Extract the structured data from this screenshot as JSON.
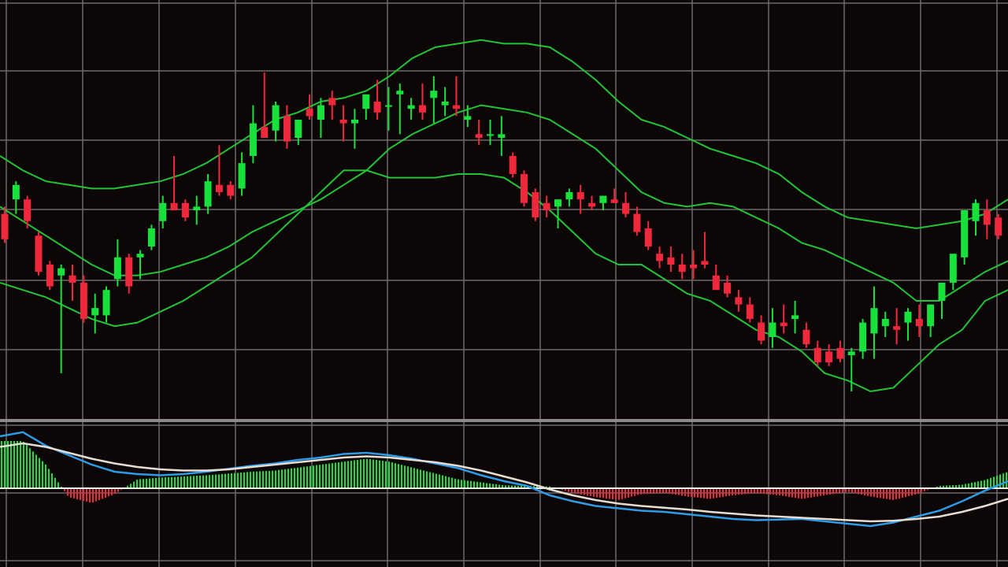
{
  "colors": {
    "background": "#0d0606",
    "grid": "#6e6a6a",
    "separator": "#8a8a8a",
    "bullish": "#19e13c",
    "bearish": "#f0283c",
    "band": "#22c437",
    "macd_line": "#2e9be6",
    "signal_line": "#e6dcd2",
    "zero_line": "#f2f2f2"
  },
  "chart_data": [
    {
      "type": "candlestick",
      "title": "",
      "xlabel": "",
      "ylabel": "",
      "ylim": [
        0,
        100
      ],
      "grid": true,
      "overlays": [
        "bollinger-upper",
        "bollinger-middle",
        "bollinger-lower"
      ],
      "candles": [
        {
          "o": 54,
          "h": 56,
          "l": 46,
          "c": 47
        },
        {
          "o": 58,
          "h": 63,
          "l": 54,
          "c": 62
        },
        {
          "o": 58,
          "h": 59,
          "l": 50,
          "c": 52
        },
        {
          "o": 48,
          "h": 49,
          "l": 37,
          "c": 38
        },
        {
          "o": 40,
          "h": 41,
          "l": 33,
          "c": 34
        },
        {
          "o": 37,
          "h": 40,
          "l": 10,
          "c": 39
        },
        {
          "o": 37,
          "h": 40,
          "l": 30,
          "c": 35
        },
        {
          "o": 35,
          "h": 37,
          "l": 24,
          "c": 25
        },
        {
          "o": 26,
          "h": 32,
          "l": 21,
          "c": 28
        },
        {
          "o": 26,
          "h": 34,
          "l": 24,
          "c": 33
        },
        {
          "o": 36,
          "h": 47,
          "l": 34,
          "c": 42
        },
        {
          "o": 42,
          "h": 43,
          "l": 32,
          "c": 34
        },
        {
          "o": 42,
          "h": 44,
          "l": 36,
          "c": 43
        },
        {
          "o": 45,
          "h": 51,
          "l": 44,
          "c": 50
        },
        {
          "o": 52,
          "h": 59,
          "l": 50,
          "c": 57
        },
        {
          "o": 57,
          "h": 70,
          "l": 55,
          "c": 55
        },
        {
          "o": 57,
          "h": 58,
          "l": 52,
          "c": 53
        },
        {
          "o": 55,
          "h": 59,
          "l": 51,
          "c": 56
        },
        {
          "o": 56,
          "h": 65,
          "l": 54,
          "c": 63
        },
        {
          "o": 62,
          "h": 73,
          "l": 59,
          "c": 60
        },
        {
          "o": 62,
          "h": 63,
          "l": 58,
          "c": 59
        },
        {
          "o": 61,
          "h": 71,
          "l": 59,
          "c": 68
        },
        {
          "o": 70,
          "h": 84,
          "l": 68,
          "c": 79
        },
        {
          "o": 78,
          "h": 93,
          "l": 75,
          "c": 75
        },
        {
          "o": 77,
          "h": 85,
          "l": 74,
          "c": 84
        },
        {
          "o": 81,
          "h": 84,
          "l": 72,
          "c": 74
        },
        {
          "o": 75,
          "h": 78,
          "l": 73,
          "c": 80
        },
        {
          "o": 83,
          "h": 87,
          "l": 80,
          "c": 81
        },
        {
          "o": 80,
          "h": 86,
          "l": 75,
          "c": 84
        },
        {
          "o": 86,
          "h": 88,
          "l": 80,
          "c": 84
        },
        {
          "o": 80,
          "h": 84,
          "l": 74,
          "c": 79
        },
        {
          "o": 79,
          "h": 83,
          "l": 72,
          "c": 80
        },
        {
          "o": 83,
          "h": 86,
          "l": 80,
          "c": 87
        },
        {
          "o": 85,
          "h": 91,
          "l": 80,
          "c": 82
        },
        {
          "o": 84,
          "h": 89,
          "l": 77,
          "c": 84
        },
        {
          "o": 87,
          "h": 90,
          "l": 76,
          "c": 88
        },
        {
          "o": 83,
          "h": 86,
          "l": 80,
          "c": 84
        },
        {
          "o": 84,
          "h": 90,
          "l": 80,
          "c": 82
        },
        {
          "o": 86,
          "h": 92,
          "l": 79,
          "c": 88
        },
        {
          "o": 84,
          "h": 89,
          "l": 81,
          "c": 85
        },
        {
          "o": 84,
          "h": 92,
          "l": 81,
          "c": 83
        },
        {
          "o": 80,
          "h": 84,
          "l": 78,
          "c": 81
        },
        {
          "o": 76,
          "h": 80,
          "l": 73,
          "c": 75
        },
        {
          "o": 76,
          "h": 80,
          "l": 73,
          "c": 76
        },
        {
          "o": 75,
          "h": 81,
          "l": 70,
          "c": 76
        },
        {
          "o": 70,
          "h": 71,
          "l": 64,
          "c": 65
        },
        {
          "o": 65,
          "h": 66,
          "l": 56,
          "c": 57
        },
        {
          "o": 60,
          "h": 61,
          "l": 52,
          "c": 53
        },
        {
          "o": 57,
          "h": 59,
          "l": 53,
          "c": 55
        },
        {
          "o": 56,
          "h": 58,
          "l": 50,
          "c": 58
        },
        {
          "o": 58,
          "h": 61,
          "l": 56,
          "c": 60
        },
        {
          "o": 60,
          "h": 62,
          "l": 54,
          "c": 58
        },
        {
          "o": 57,
          "h": 59,
          "l": 55,
          "c": 56
        },
        {
          "o": 57,
          "h": 59,
          "l": 55,
          "c": 59
        },
        {
          "o": 58,
          "h": 61,
          "l": 57,
          "c": 57
        },
        {
          "o": 57,
          "h": 60,
          "l": 53,
          "c": 54
        },
        {
          "o": 54,
          "h": 56,
          "l": 48,
          "c": 49
        },
        {
          "o": 50,
          "h": 52,
          "l": 44,
          "c": 45
        },
        {
          "o": 43,
          "h": 45,
          "l": 39,
          "c": 41
        },
        {
          "o": 42,
          "h": 45,
          "l": 38,
          "c": 40
        },
        {
          "o": 40,
          "h": 43,
          "l": 36,
          "c": 38
        },
        {
          "o": 40,
          "h": 44,
          "l": 36,
          "c": 39
        },
        {
          "o": 41,
          "h": 49,
          "l": 39,
          "c": 40
        },
        {
          "o": 37,
          "h": 40,
          "l": 33,
          "c": 33
        },
        {
          "o": 35,
          "h": 37,
          "l": 31,
          "c": 32
        },
        {
          "o": 31,
          "h": 33,
          "l": 27,
          "c": 29
        },
        {
          "o": 29,
          "h": 31,
          "l": 24,
          "c": 25
        },
        {
          "o": 24,
          "h": 26,
          "l": 18,
          "c": 19
        },
        {
          "o": 20,
          "h": 28,
          "l": 17,
          "c": 24
        },
        {
          "o": 24,
          "h": 29,
          "l": 21,
          "c": 23
        },
        {
          "o": 25,
          "h": 30,
          "l": 21,
          "c": 26
        },
        {
          "o": 22,
          "h": 24,
          "l": 17,
          "c": 18
        },
        {
          "o": 17,
          "h": 19,
          "l": 12,
          "c": 13
        },
        {
          "o": 16,
          "h": 18,
          "l": 12,
          "c": 13
        },
        {
          "o": 17,
          "h": 19,
          "l": 13,
          "c": 14
        },
        {
          "o": 15,
          "h": 17,
          "l": 5,
          "c": 16
        },
        {
          "o": 16,
          "h": 25,
          "l": 14,
          "c": 24
        },
        {
          "o": 21,
          "h": 34,
          "l": 14,
          "c": 28
        },
        {
          "o": 23,
          "h": 27,
          "l": 20,
          "c": 25
        },
        {
          "o": 23,
          "h": 28,
          "l": 18,
          "c": 22
        },
        {
          "o": 24,
          "h": 28,
          "l": 19,
          "c": 27
        },
        {
          "o": 25,
          "h": 29,
          "l": 20,
          "c": 23
        },
        {
          "o": 23,
          "h": 29,
          "l": 20,
          "c": 29
        },
        {
          "o": 30,
          "h": 35,
          "l": 25,
          "c": 35
        },
        {
          "o": 35,
          "h": 42,
          "l": 33,
          "c": 43
        },
        {
          "o": 42,
          "h": 48,
          "l": 40,
          "c": 55
        },
        {
          "o": 52,
          "h": 58,
          "l": 48,
          "c": 57
        },
        {
          "o": 55,
          "h": 58,
          "l": 47,
          "c": 51
        },
        {
          "o": 53,
          "h": 54,
          "l": 47,
          "c": 48
        }
      ],
      "bands": {
        "upper": [
          70,
          66,
          63,
          62,
          61,
          61,
          62,
          63,
          65,
          68,
          72,
          76,
          80,
          82,
          85,
          86,
          88,
          92,
          97,
          100,
          101,
          102,
          101,
          101,
          100,
          96,
          91,
          85,
          80,
          78,
          75,
          72,
          70,
          68,
          65,
          60,
          56,
          53,
          52,
          51,
          50,
          51,
          52,
          54,
          58
        ],
        "middle": [
          56,
          52,
          48,
          44,
          40,
          37,
          37,
          38,
          40,
          42,
          45,
          49,
          52,
          55,
          58,
          62,
          66,
          72,
          76,
          79,
          82,
          84,
          83,
          82,
          80,
          76,
          72,
          66,
          60,
          57,
          56,
          57,
          56,
          53,
          50,
          46,
          44,
          41,
          38,
          35,
          30,
          30,
          34,
          38,
          41
        ],
        "lower": [
          35,
          33,
          31,
          28,
          25,
          23,
          24,
          27,
          30,
          34,
          38,
          42,
          48,
          54,
          60,
          66,
          66,
          64,
          64,
          64,
          65,
          65,
          64,
          60,
          55,
          49,
          43,
          40,
          40,
          36,
          32,
          30,
          26,
          22,
          20,
          16,
          10,
          8,
          5,
          6,
          12,
          18,
          22,
          30,
          33
        ]
      }
    },
    {
      "type": "macd",
      "title": "",
      "xlabel": "",
      "ylabel": "",
      "ylim": [
        -100,
        100
      ],
      "grid": true,
      "macd": [
        88,
        95,
        72,
        56,
        40,
        28,
        24,
        22,
        24,
        28,
        33,
        38,
        42,
        48,
        52,
        58,
        60,
        56,
        50,
        42,
        34,
        22,
        12,
        4,
        -12,
        -22,
        -30,
        -34,
        -38,
        -40,
        -44,
        -48,
        -52,
        -54,
        -53,
        -52,
        -56,
        -60,
        -64,
        -58,
        -48,
        -38,
        -22,
        -4,
        12
      ],
      "signal": [
        70,
        76,
        70,
        60,
        50,
        42,
        36,
        32,
        30,
        30,
        32,
        36,
        40,
        44,
        48,
        52,
        54,
        52,
        48,
        44,
        38,
        30,
        20,
        10,
        -2,
        -12,
        -20,
        -26,
        -30,
        -33,
        -36,
        -40,
        -43,
        -46,
        -48,
        -50,
        -52,
        -54,
        -56,
        -55,
        -52,
        -48,
        -40,
        -30,
        -18
      ],
      "histogram": [
        80,
        80,
        40,
        -15,
        -25,
        -10,
        15,
        18,
        20,
        22,
        25,
        28,
        30,
        35,
        40,
        45,
        50,
        45,
        35,
        25,
        15,
        10,
        5,
        4,
        3,
        -8,
        -15,
        -20,
        -10,
        -8,
        -14,
        -18,
        -12,
        -8,
        -12,
        -18,
        -12,
        -6,
        -14,
        -20,
        -10,
        4,
        6,
        14,
        28
      ]
    }
  ]
}
